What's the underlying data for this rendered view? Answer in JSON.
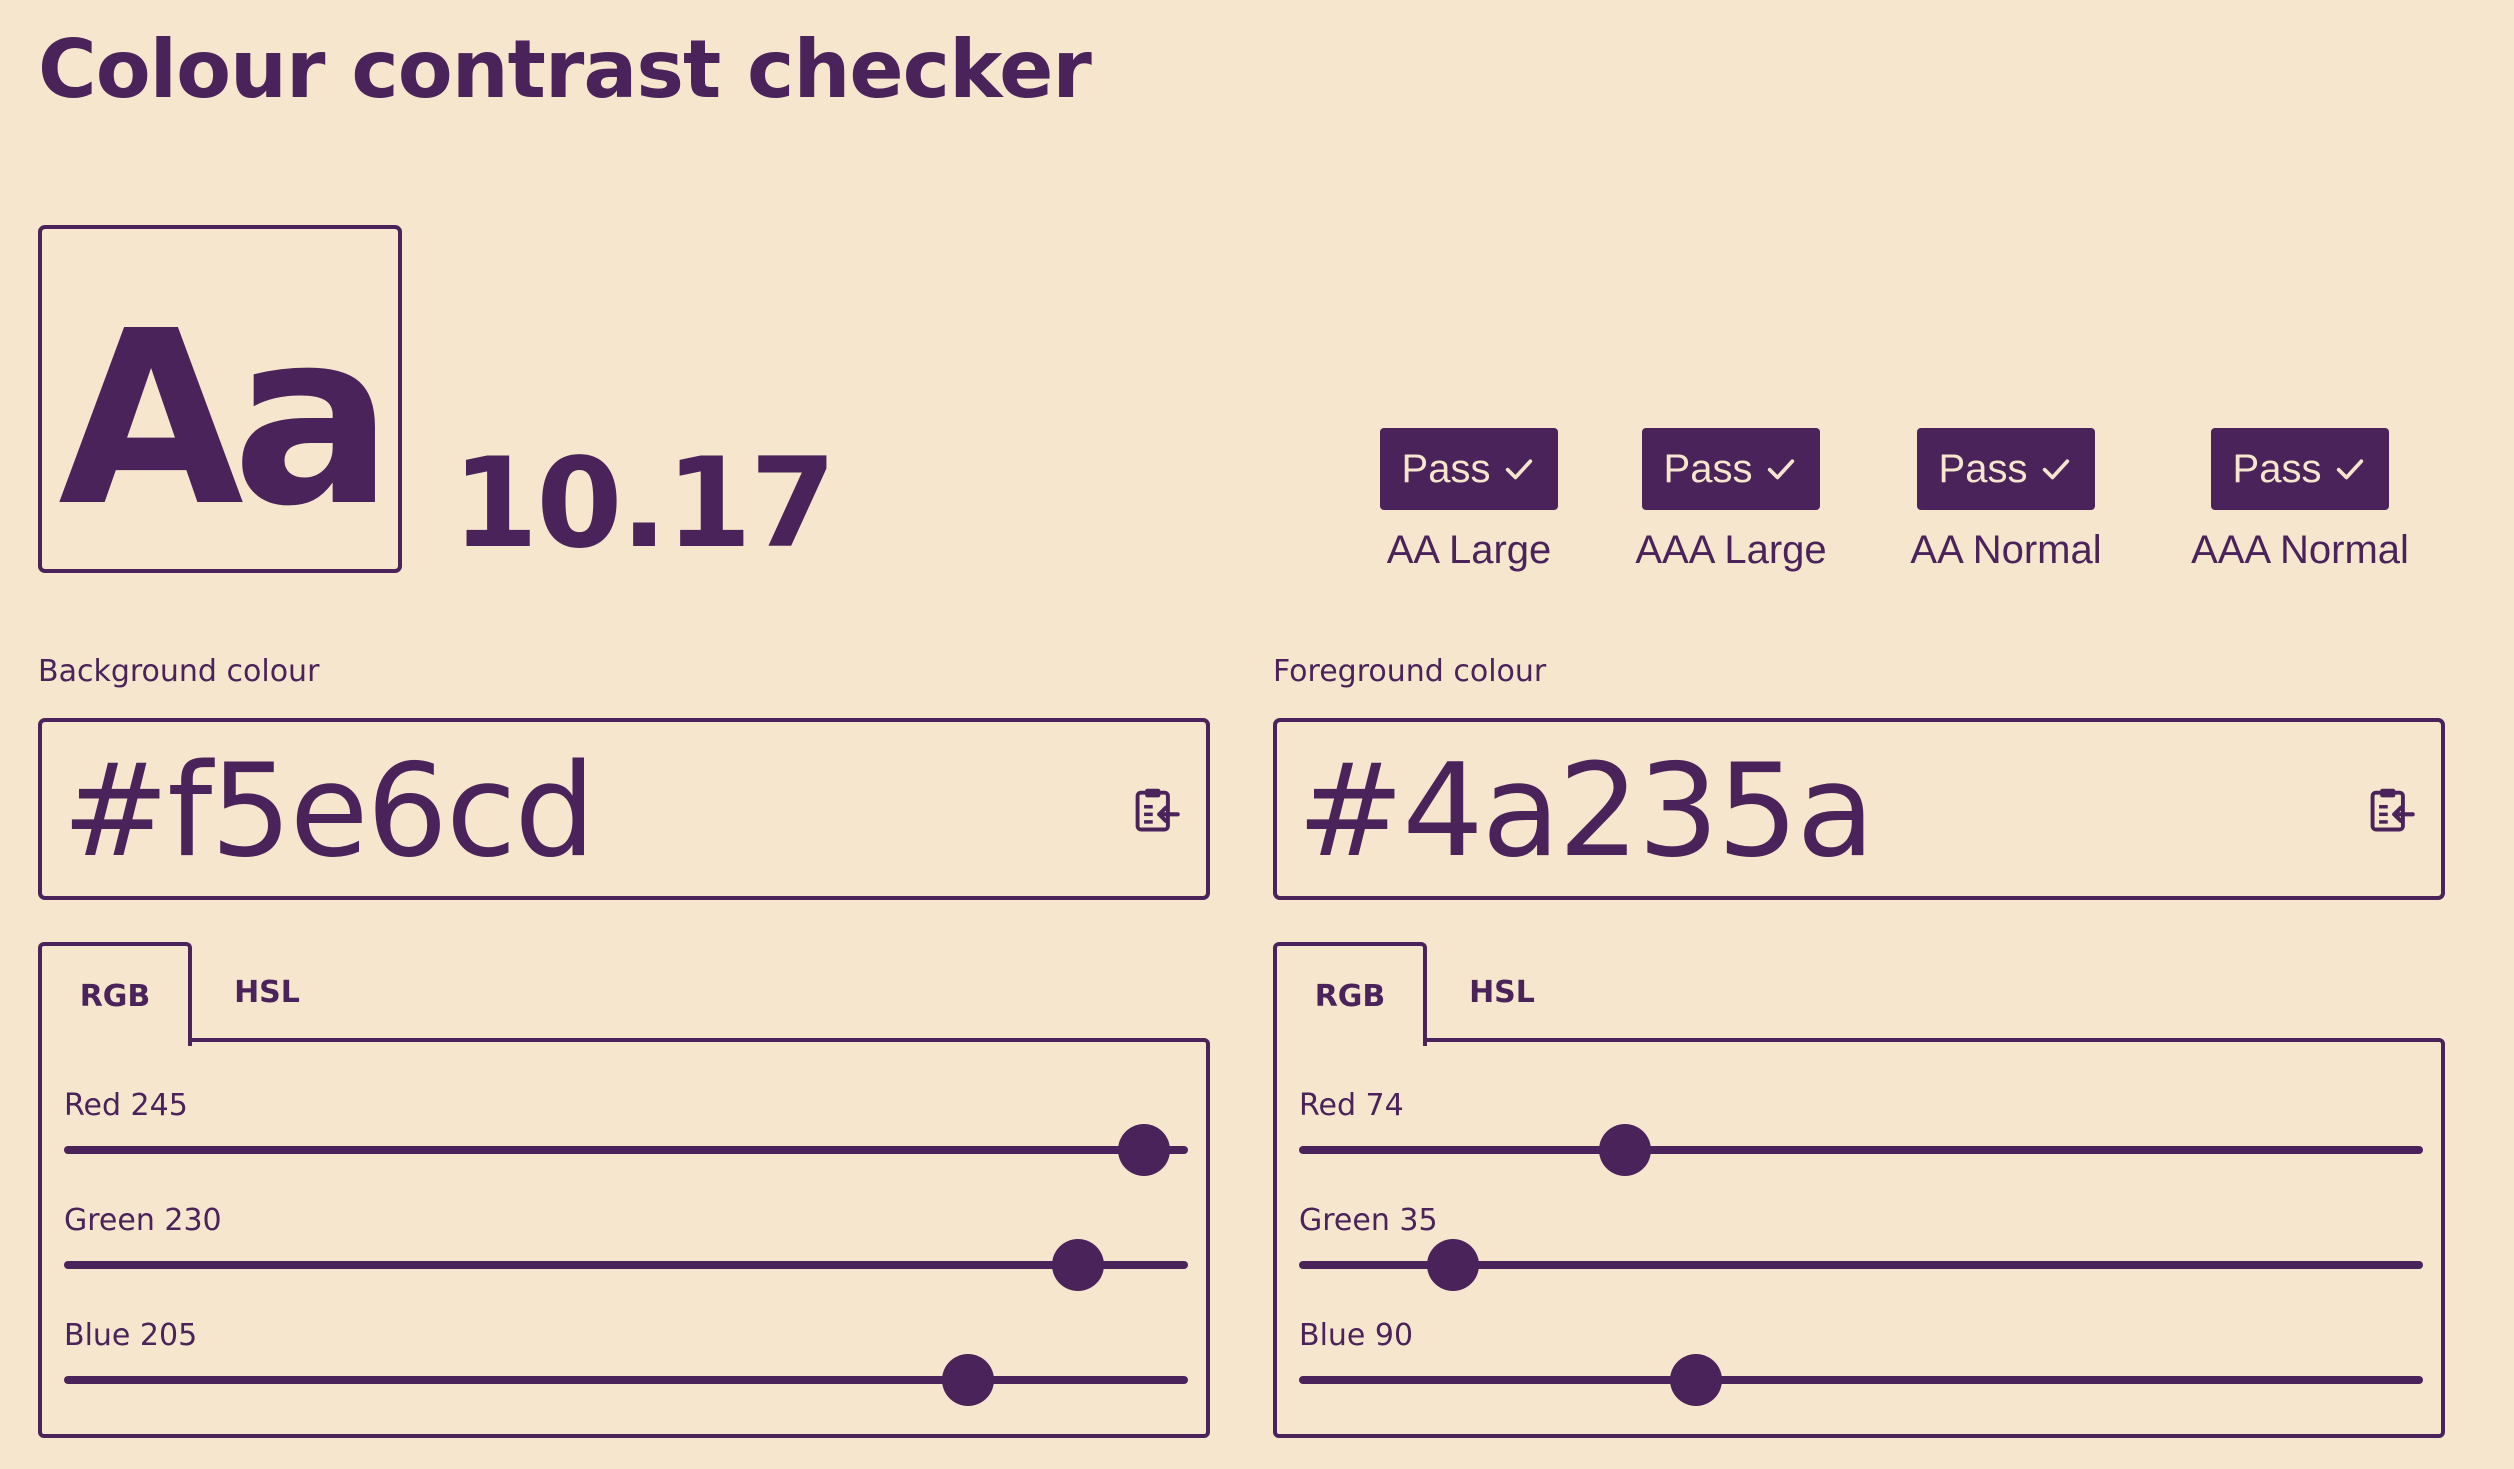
{
  "page": {
    "title": "Colour contrast checker"
  },
  "sample": {
    "text": "Aa"
  },
  "contrast": {
    "ratio": "10.17"
  },
  "results": [
    {
      "badge": "Pass",
      "icon": "check-icon",
      "level": "AA Large"
    },
    {
      "badge": "Pass",
      "icon": "check-icon",
      "level": "AAA Large"
    },
    {
      "badge": "Pass",
      "icon": "check-icon",
      "level": "AA Normal"
    },
    {
      "badge": "Pass",
      "icon": "check-icon",
      "level": "AAA Normal"
    }
  ],
  "background": {
    "label": "Background colour",
    "hex": "#f5e6cd",
    "paste_icon": "paste-icon",
    "tabs": [
      "RGB",
      "HSL"
    ],
    "active_tab": "RGB",
    "sliders": [
      {
        "label": "Red 245",
        "value": 245,
        "max": 255
      },
      {
        "label": "Green 230",
        "value": 230,
        "max": 255
      },
      {
        "label": "Blue 205",
        "value": 205,
        "max": 255
      }
    ]
  },
  "foreground": {
    "label": "Foreground colour",
    "hex": "#4a235a",
    "paste_icon": "paste-icon",
    "tabs": [
      "RGB",
      "HSL"
    ],
    "active_tab": "RGB",
    "sliders": [
      {
        "label": "Red 74",
        "value": 74,
        "max": 255
      },
      {
        "label": "Green 35",
        "value": 35,
        "max": 255
      },
      {
        "label": "Blue 90",
        "value": 90,
        "max": 255
      }
    ]
  },
  "colors": {
    "background": "#f5e6cd",
    "foreground": "#4a235a"
  }
}
